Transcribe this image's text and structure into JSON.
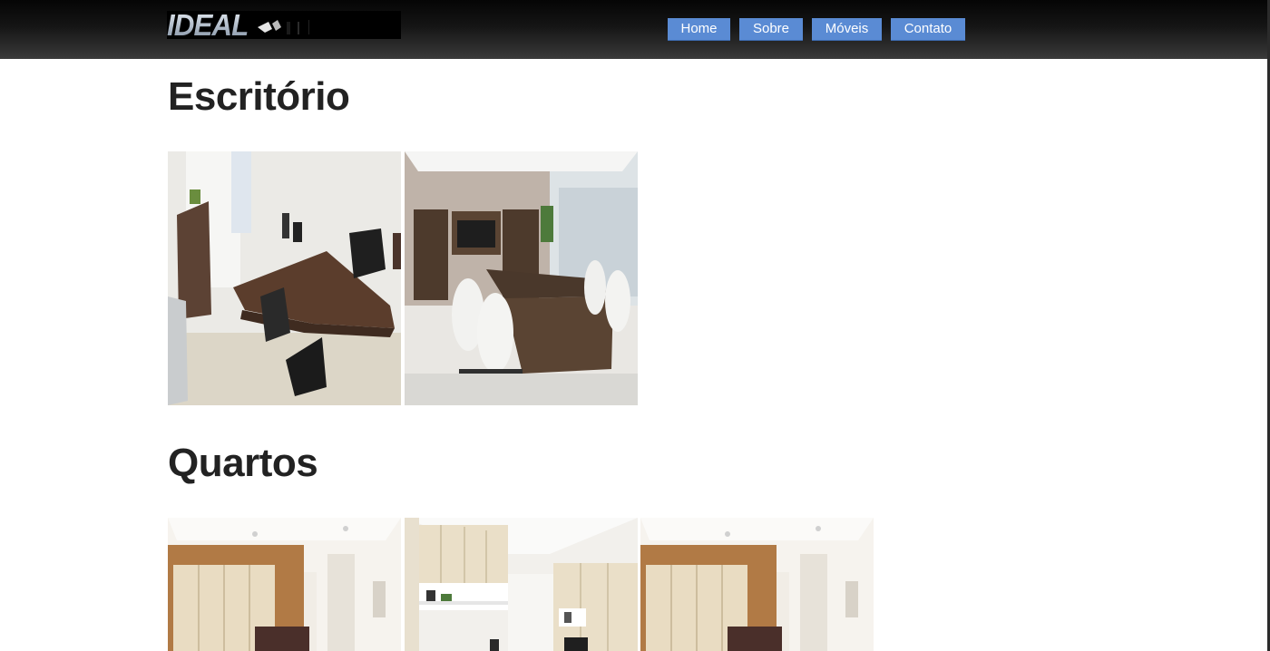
{
  "brand": {
    "logo_text": "IDEAL"
  },
  "nav": {
    "items": [
      {
        "label": "Home"
      },
      {
        "label": "Sobre"
      },
      {
        "label": "Móveis"
      },
      {
        "label": "Contato"
      }
    ]
  },
  "sections": [
    {
      "title": "Escritório",
      "photo_icon": "office-photo",
      "photo_count": 2
    },
    {
      "title": "Quartos",
      "photo_icon": "bedroom-photo",
      "photo_count": 3
    }
  ],
  "colors": {
    "nav_button": "#5a8bd4",
    "header_top": "#050505",
    "logo_accent": "#d7212b"
  }
}
